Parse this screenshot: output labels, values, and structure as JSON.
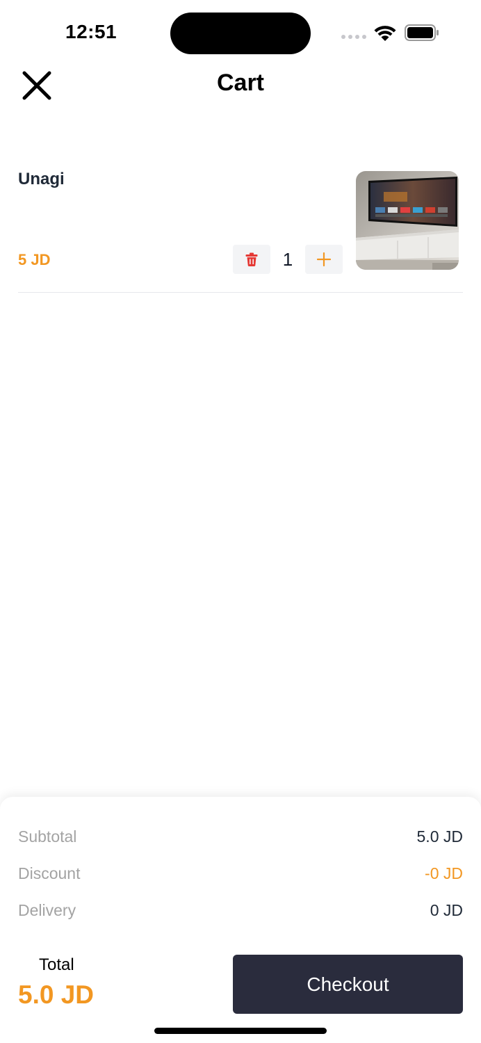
{
  "status_bar": {
    "time": "12:51",
    "icons": [
      "cellular-signal-icon",
      "wifi-icon",
      "battery-icon"
    ]
  },
  "header": {
    "title": "Cart",
    "close_icon": "close-icon"
  },
  "cart": {
    "items": [
      {
        "name": "Unagi",
        "price": "5 JD",
        "quantity": "1",
        "image_icon": "product-thumbnail-tv",
        "delete_icon": "trash-icon",
        "increment_icon": "plus-icon"
      }
    ]
  },
  "summary": {
    "subtotal_label": "Subtotal",
    "subtotal_value": "5.0 JD",
    "discount_label": "Discount",
    "discount_value": "-0 JD",
    "delivery_label": "Delivery",
    "delivery_value": "0 JD",
    "total_label": "Total",
    "total_value": "5.0 JD",
    "checkout_label": "Checkout"
  },
  "colors": {
    "accent": "#f29722",
    "delete_red": "#e53935",
    "checkout_bg": "#2a2c3d",
    "muted_text": "#a3a3a3"
  }
}
